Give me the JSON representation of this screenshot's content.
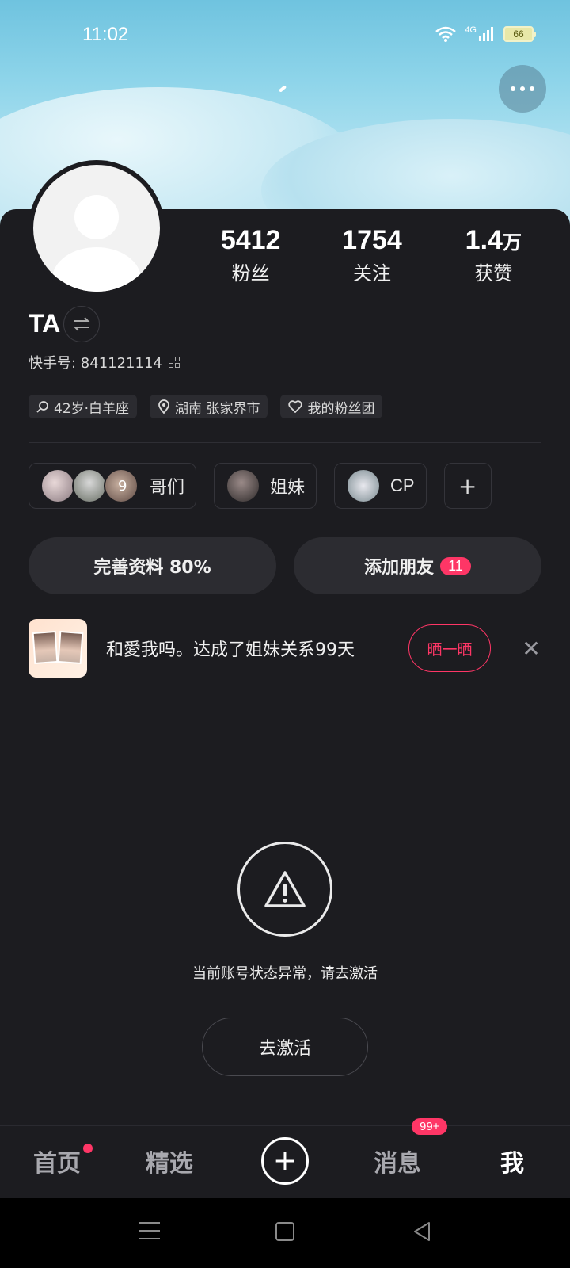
{
  "status_bar": {
    "time": "11:02",
    "network": "4G",
    "battery": "66"
  },
  "profile": {
    "username": "TA",
    "kuaishou_id": "快手号: 841121114",
    "stats": [
      {
        "number": "5412",
        "unit": "",
        "label": "粉丝"
      },
      {
        "number": "1754",
        "unit": "",
        "label": "关注"
      },
      {
        "number": "1.4",
        "unit": "万",
        "label": "获赞"
      }
    ],
    "tags": [
      {
        "icon": "search-icon",
        "label": "42岁·白羊座"
      },
      {
        "icon": "location-icon",
        "label": "湖南 张家界市"
      },
      {
        "icon": "heart-icon",
        "label": "我的粉丝团"
      }
    ],
    "relations": [
      {
        "label": "哥们",
        "count": "9"
      },
      {
        "label": "姐妹"
      },
      {
        "label": "CP"
      }
    ],
    "add_relation_symbol": "+"
  },
  "actions": {
    "complete_profile": "完善资料 80%",
    "add_friend": "添加朋友",
    "add_friend_badge": "11"
  },
  "notice": {
    "text": "和愛我吗。达成了姐妹关系99天",
    "share_label": "晒一晒",
    "close_symbol": "✕"
  },
  "warning": {
    "message": "当前账号状态异常，请去激活",
    "activate_label": "去激活"
  },
  "tabbar": {
    "home": "首页",
    "featured": "精选",
    "post": "+",
    "messages": "消息",
    "messages_badge": "99+",
    "me": "我"
  },
  "colors": {
    "accent": "#fe3666",
    "background": "#1c1c20",
    "banner": "#8fd5ea"
  }
}
